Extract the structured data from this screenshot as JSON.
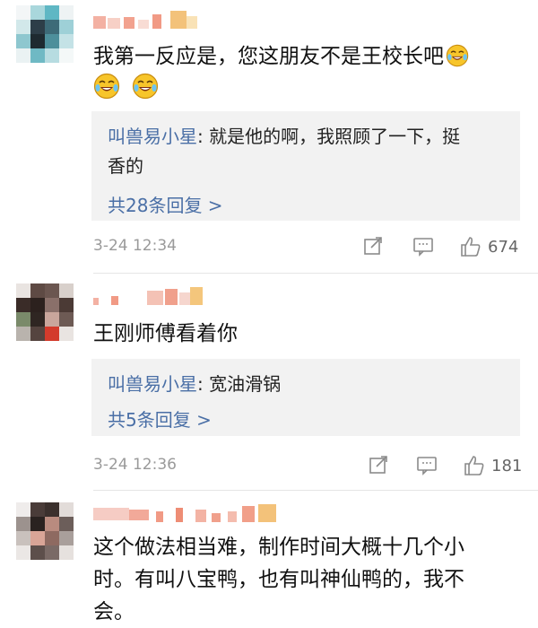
{
  "comments": [
    {
      "text": "我第一反应是，您这朋友不是王校长吧",
      "reply": {
        "user": "叫兽易小星",
        "sep": ": ",
        "text_line1": "就是他的啊，我照顾了一下，挺",
        "text_line2": "香的"
      },
      "reply_count": "共28条回复 >",
      "time": "3-24 12:34",
      "likes": "674"
    },
    {
      "text": "王刚师傅看着你",
      "reply": {
        "user": "叫兽易小星",
        "sep": ": ",
        "text_line1": "宽油滑锅"
      },
      "reply_count": "共5条回复 >",
      "time": "3-24 12:36",
      "likes": "181"
    },
    {
      "text_line1": "这个做法相当难，制作时间大概十几个小",
      "text_line2": "时。有叫八宝鸭，也有叫神仙鸭的，我不",
      "text_line3": "会。"
    }
  ],
  "icons": {
    "emoji": "laugh-cry-emoji",
    "share": "share-icon",
    "reply": "comment-icon",
    "like": "thumbs-up-icon"
  },
  "colors": {
    "link": "#4a6fa6",
    "reply_bg": "#f2f2f2",
    "meta": "#9a9a9a"
  }
}
